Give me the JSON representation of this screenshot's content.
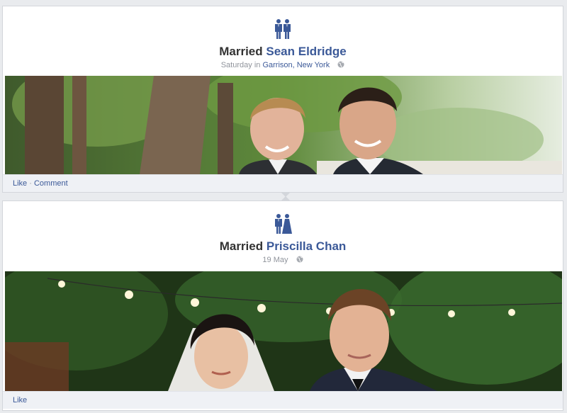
{
  "stories": [
    {
      "event_icon": "two-grooms-icon",
      "title_prefix": "Married",
      "person": "Sean Eldridge",
      "date": "Saturday",
      "in_word": "in",
      "place": "Garrison, New York",
      "privacy_icon": "globe-icon",
      "photo": "wedding-photo-two-grooms",
      "actions": {
        "like": "Like",
        "separator": "·",
        "comment": "Comment"
      }
    },
    {
      "event_icon": "bride-and-groom-icon",
      "title_prefix": "Married",
      "person": "Priscilla Chan",
      "date": "19 May",
      "privacy_icon": "globe-icon",
      "photo": "wedding-photo-bride-and-groom",
      "actions": {
        "like": "Like"
      }
    }
  ],
  "colors": {
    "link": "#3b5998",
    "title": "#333333",
    "meta": "#90949c",
    "action_bar": "#eff1f5"
  }
}
